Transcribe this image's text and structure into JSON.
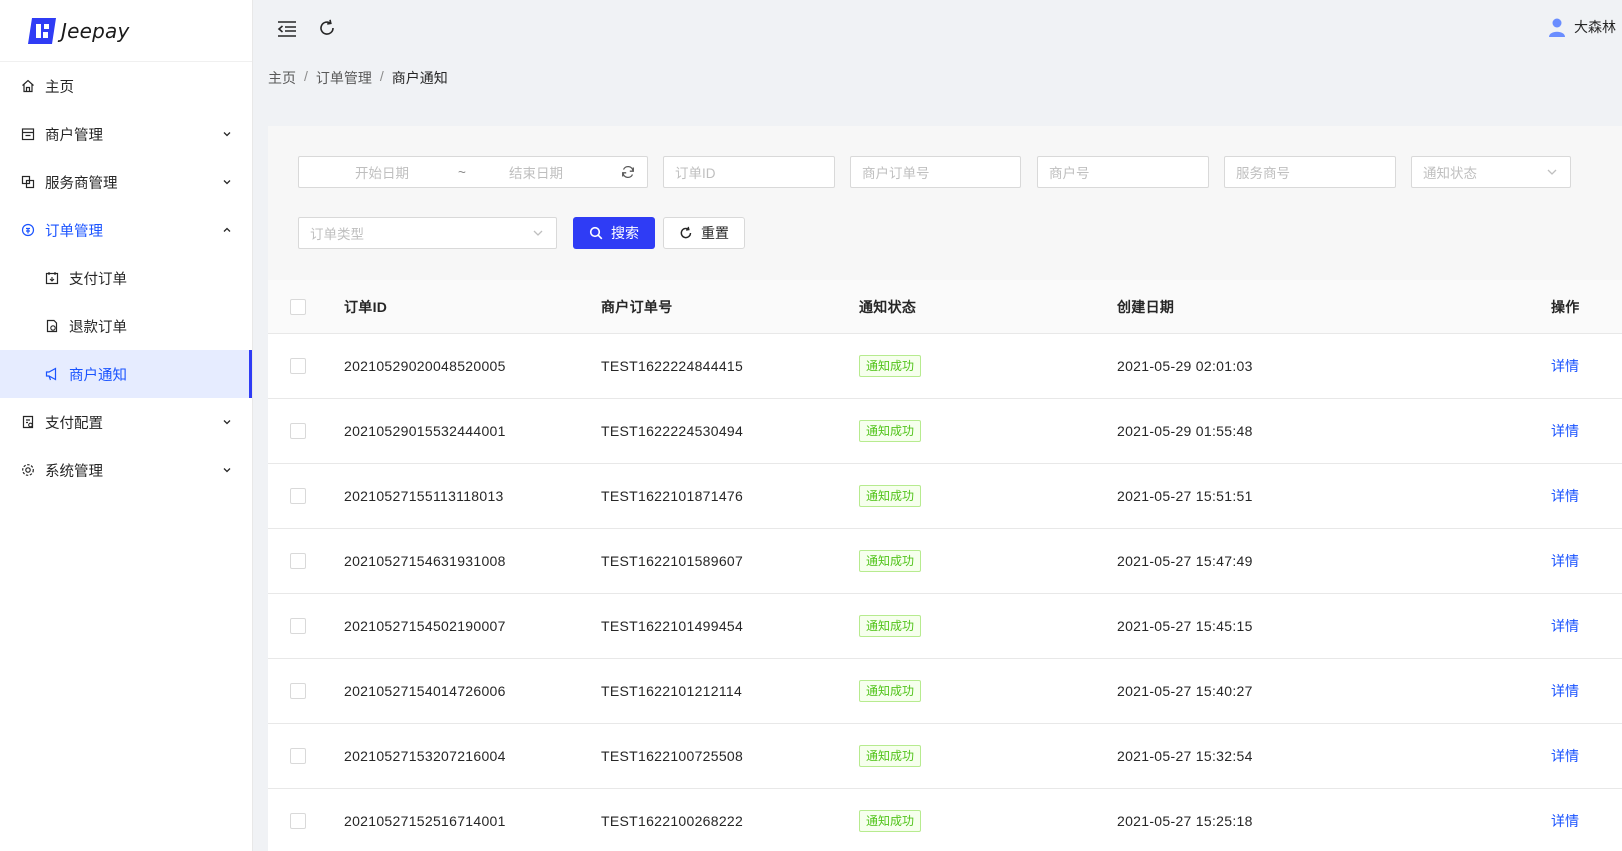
{
  "app": {
    "brand": "Jeepay"
  },
  "sidebar": {
    "items": [
      {
        "label": "主页",
        "icon": "home-icon"
      },
      {
        "label": "商户管理",
        "icon": "shop-icon"
      },
      {
        "label": "服务商管理",
        "icon": "partner-icon"
      },
      {
        "label": "订单管理",
        "icon": "order-icon"
      },
      {
        "label": "支付订单",
        "icon": "pay-order-icon"
      },
      {
        "label": "退款订单",
        "icon": "refund-order-icon"
      },
      {
        "label": "商户通知",
        "icon": "notify-icon"
      },
      {
        "label": "支付配置",
        "icon": "pay-config-icon"
      },
      {
        "label": "系统管理",
        "icon": "settings-icon"
      }
    ]
  },
  "header": {
    "user": "大森林"
  },
  "breadcrumb": {
    "home": "主页",
    "section": "订单管理",
    "current": "商户通知"
  },
  "filters": {
    "start_date": "开始日期",
    "date_sep": "~",
    "end_date": "结束日期",
    "order_id": "订单ID",
    "mch_order_no": "商户订单号",
    "mch_no": "商户号",
    "isv_no": "服务商号",
    "notify_state": "通知状态",
    "order_type": "订单类型",
    "search": "搜索",
    "reset": "重置"
  },
  "table": {
    "columns": [
      "订单ID",
      "商户订单号",
      "通知状态",
      "创建日期",
      "操作"
    ],
    "rows": [
      {
        "order_id": "20210529020048520005",
        "mch_order_no": "TEST1622224844415",
        "status": "通知成功",
        "created": "2021-05-29 02:01:03",
        "action": "详情"
      },
      {
        "order_id": "20210529015532444001",
        "mch_order_no": "TEST1622224530494",
        "status": "通知成功",
        "created": "2021-05-29 01:55:48",
        "action": "详情"
      },
      {
        "order_id": "20210527155113118013",
        "mch_order_no": "TEST1622101871476",
        "status": "通知成功",
        "created": "2021-05-27 15:51:51",
        "action": "详情"
      },
      {
        "order_id": "20210527154631931008",
        "mch_order_no": "TEST1622101589607",
        "status": "通知成功",
        "created": "2021-05-27 15:47:49",
        "action": "详情"
      },
      {
        "order_id": "20210527154502190007",
        "mch_order_no": "TEST1622101499454",
        "status": "通知成功",
        "created": "2021-05-27 15:45:15",
        "action": "详情"
      },
      {
        "order_id": "20210527154014726006",
        "mch_order_no": "TEST1622101212114",
        "status": "通知成功",
        "created": "2021-05-27 15:40:27",
        "action": "详情"
      },
      {
        "order_id": "20210527153207216004",
        "mch_order_no": "TEST1622100725508",
        "status": "通知成功",
        "created": "2021-05-27 15:32:54",
        "action": "详情"
      },
      {
        "order_id": "20210527152516714001",
        "mch_order_no": "TEST1622100268222",
        "status": "通知成功",
        "created": "2021-05-27 15:25:18",
        "action": "详情"
      }
    ]
  },
  "colors": {
    "primary": "#2f3cf5",
    "link": "#1a53ff",
    "success": "#52c41a"
  }
}
